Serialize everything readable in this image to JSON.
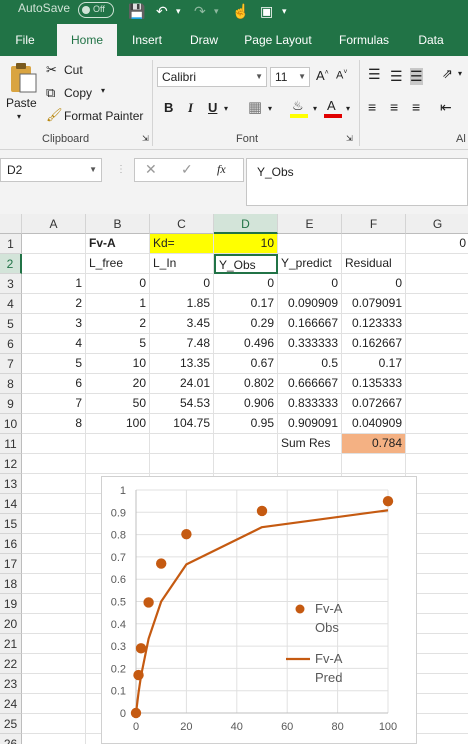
{
  "titlebar": {
    "autosave_label": "AutoSave",
    "autosave_state": "Off"
  },
  "tabs": [
    "File",
    "Home",
    "Insert",
    "Draw",
    "Page Layout",
    "Formulas",
    "Data"
  ],
  "ribbon": {
    "clipboard": {
      "paste": "Paste",
      "cut": "Cut",
      "copy": "Copy",
      "format_painter": "Format Painter",
      "label": "Clipboard"
    },
    "font": {
      "name": "Calibri",
      "size": "11",
      "label": "Font",
      "bold": "B",
      "italic": "I",
      "underline": "U"
    },
    "alignment_label": "Al"
  },
  "formula_bar": {
    "name_box": "D2",
    "content": "Y_Obs",
    "fx": "fx"
  },
  "columns": [
    "A",
    "B",
    "C",
    "D",
    "E",
    "F",
    "G"
  ],
  "rows": [
    "1",
    "2",
    "3",
    "4",
    "5",
    "6",
    "7",
    "8",
    "9",
    "10",
    "11",
    "12",
    "13",
    "14",
    "15",
    "16",
    "17",
    "18",
    "19",
    "20",
    "21",
    "22",
    "23",
    "24",
    "25",
    "26"
  ],
  "sheet": {
    "r1": {
      "b": "Fv-A",
      "c": "Kd=",
      "d": "10",
      "g": "0"
    },
    "r2": {
      "b": "L_free",
      "c": "L_In",
      "d": "Y_Obs",
      "e": "Y_predict",
      "f": "Residual"
    },
    "data": [
      [
        "1",
        "0",
        "0",
        "0",
        "0",
        "0"
      ],
      [
        "2",
        "1",
        "1.85",
        "0.17",
        "0.090909",
        "0.079091"
      ],
      [
        "3",
        "2",
        "3.45",
        "0.29",
        "0.166667",
        "0.123333"
      ],
      [
        "4",
        "5",
        "7.48",
        "0.496",
        "0.333333",
        "0.162667"
      ],
      [
        "5",
        "10",
        "13.35",
        "0.67",
        "0.5",
        "0.17"
      ],
      [
        "6",
        "20",
        "24.01",
        "0.802",
        "0.666667",
        "0.135333"
      ],
      [
        "7",
        "50",
        "54.53",
        "0.906",
        "0.833333",
        "0.072667"
      ],
      [
        "8",
        "100",
        "104.75",
        "0.95",
        "0.909091",
        "0.040909"
      ]
    ],
    "r11": {
      "e": "Sum Res",
      "f": "0.784"
    }
  },
  "colors": {
    "excel_green": "#217346",
    "kd_highlight": "#ffff00",
    "sumres_highlight": "#f4b183",
    "series": "#c55a11"
  },
  "chart_data": {
    "type": "scatter",
    "xlim": [
      0,
      100
    ],
    "ylim": [
      0,
      1
    ],
    "xticks": [
      "0",
      "20",
      "40",
      "60",
      "80",
      "100"
    ],
    "yticks": [
      "0",
      "0.1",
      "0.2",
      "0.3",
      "0.4",
      "0.5",
      "0.6",
      "0.7",
      "0.8",
      "0.9",
      "1"
    ],
    "series": [
      {
        "name": "Fv-A Obs",
        "kind": "markers",
        "x": [
          0,
          1,
          2,
          5,
          10,
          20,
          50,
          100
        ],
        "y": [
          0,
          0.17,
          0.29,
          0.496,
          0.67,
          0.802,
          0.906,
          0.95
        ]
      },
      {
        "name": "Fv-A Pred",
        "kind": "line",
        "x": [
          0,
          1,
          2,
          5,
          10,
          20,
          50,
          100
        ],
        "y": [
          0,
          0.090909,
          0.166667,
          0.333333,
          0.5,
          0.666667,
          0.833333,
          0.909091
        ]
      }
    ],
    "legend": [
      "Fv-A Obs",
      "Fv-A Pred"
    ],
    "legend_position": "right"
  }
}
